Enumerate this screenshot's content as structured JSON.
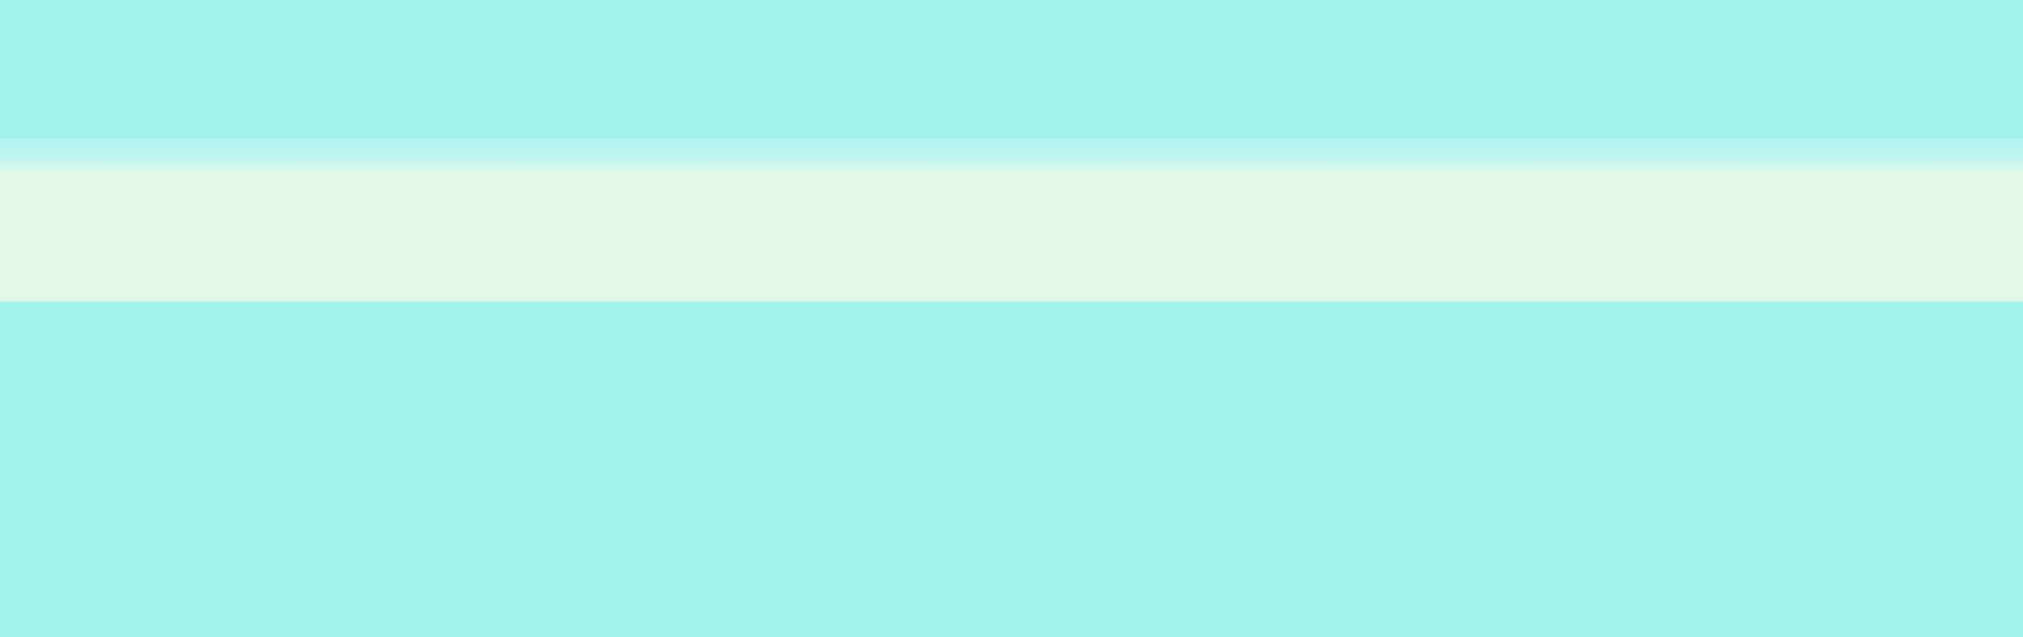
{
  "colors": {
    "background": "#a2f2ec",
    "glow": "#bcf6f2",
    "strip": "#e2f9e9",
    "strip_edge": "#c3f4ea"
  }
}
